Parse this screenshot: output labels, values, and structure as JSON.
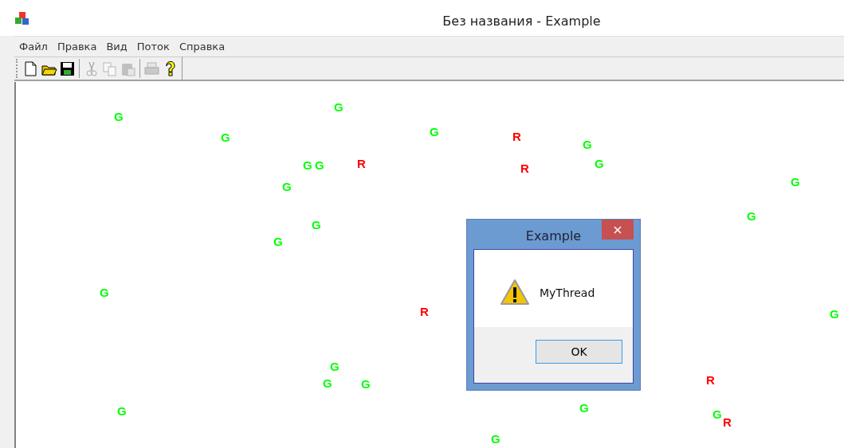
{
  "window": {
    "title": "Без названия - Example"
  },
  "menu": [
    "Файл",
    "Правка",
    "Вид",
    "Поток",
    "Справка"
  ],
  "toolbar": [
    {
      "disabled": false
    },
    {
      "disabled": false
    },
    {
      "disabled": false
    },
    {
      "disabled": true
    },
    {
      "disabled": true
    },
    {
      "disabled": true
    },
    {
      "disabled": true
    },
    {
      "disabled": false
    }
  ],
  "canvas_letters": [
    {
      "text": "G",
      "color": "#00ff00"
    },
    {
      "text": "G",
      "color": "#00ff00"
    },
    {
      "text": "G",
      "color": "#00ff00"
    },
    {
      "text": "G",
      "color": "#00ff00"
    },
    {
      "text": "R",
      "color": "#ff0000"
    },
    {
      "text": "G",
      "color": "#00ff00"
    },
    {
      "text": "G",
      "color": "#00ff00"
    },
    {
      "text": "G",
      "color": "#00ff00"
    },
    {
      "text": "R",
      "color": "#ff0000"
    },
    {
      "text": "R",
      "color": "#ff0000"
    },
    {
      "text": "G",
      "color": "#00ff00"
    },
    {
      "text": "G",
      "color": "#00ff00"
    },
    {
      "text": "G",
      "color": "#00ff00"
    },
    {
      "text": "G",
      "color": "#00ff00"
    },
    {
      "text": "G",
      "color": "#00ff00"
    },
    {
      "text": "G",
      "color": "#00ff00"
    },
    {
      "text": "G",
      "color": "#00ff00"
    },
    {
      "text": "R",
      "color": "#ff0000"
    },
    {
      "text": "G",
      "color": "#00ff00"
    },
    {
      "text": "G",
      "color": "#00ff00"
    },
    {
      "text": "G",
      "color": "#00ff00"
    },
    {
      "text": "G",
      "color": "#00ff00"
    },
    {
      "text": "R",
      "color": "#ff0000"
    },
    {
      "text": "G",
      "color": "#00ff00"
    },
    {
      "text": "G",
      "color": "#00ff00"
    },
    {
      "text": "G",
      "color": "#00ff00"
    },
    {
      "text": "R",
      "color": "#ff0000"
    },
    {
      "text": "G",
      "color": "#00ff00"
    }
  ],
  "dialog": {
    "title": "Example",
    "close": "×",
    "message": "MyThread",
    "button": "OK"
  }
}
